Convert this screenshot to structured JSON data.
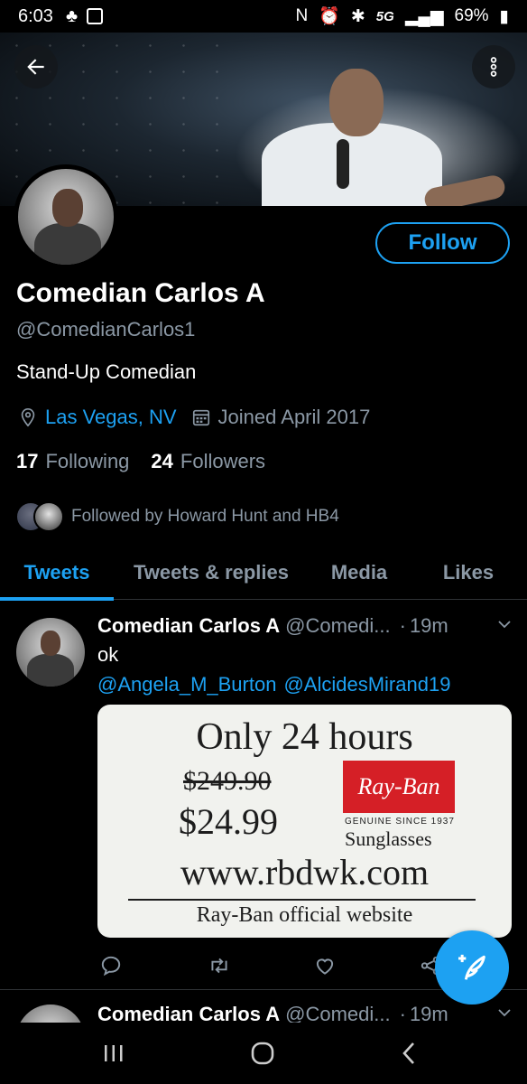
{
  "status_bar": {
    "time": "6:03",
    "network": "5G",
    "battery": "69%"
  },
  "profile": {
    "display_name": "Comedian Carlos A",
    "handle": "@ComedianCarlos1",
    "bio": "Stand-Up Comedian",
    "location": "Las Vegas, NV",
    "joined": "Joined April 2017",
    "following_count": "17",
    "following_label": "Following",
    "followers_count": "24",
    "followers_label": "Followers",
    "followed_by": "Followed by Howard Hunt and HB4",
    "follow_button": "Follow"
  },
  "tabs": [
    {
      "label": "Tweets",
      "active": true
    },
    {
      "label": "Tweets & replies",
      "active": false
    },
    {
      "label": "Media",
      "active": false
    },
    {
      "label": "Likes",
      "active": false
    }
  ],
  "tweets": [
    {
      "name": "Comedian Carlos A",
      "handle": "@Comedi...",
      "dot": "·",
      "time": "19m",
      "text": "ok",
      "mentions": [
        "@Angela_M_Burton",
        "@AlcidesMirand19"
      ],
      "image": {
        "line1": "Only 24 hours",
        "old_price": "$249.90",
        "new_price": "$24.99",
        "logo": "Ray-Ban",
        "since": "GENUINE SINCE 1937",
        "product": "Sunglasses",
        "url": "www.rbdwk.com",
        "official": "Ray-Ban official website"
      }
    },
    {
      "name": "Comedian Carlos A",
      "handle": "@Comedi...",
      "dot": "·",
      "time": "19m"
    }
  ],
  "icons": {
    "back": "arrow-left-icon",
    "more": "more-vertical-icon",
    "location": "location-pin-icon",
    "calendar": "calendar-icon",
    "reply": "reply-icon",
    "retweet": "retweet-icon",
    "like": "heart-icon",
    "share": "share-icon",
    "compose": "compose-tweet-icon"
  },
  "colors": {
    "accent": "#1da1f2",
    "background": "#000000",
    "secondary_text": "#8b98a5",
    "divider": "#2f3336"
  }
}
